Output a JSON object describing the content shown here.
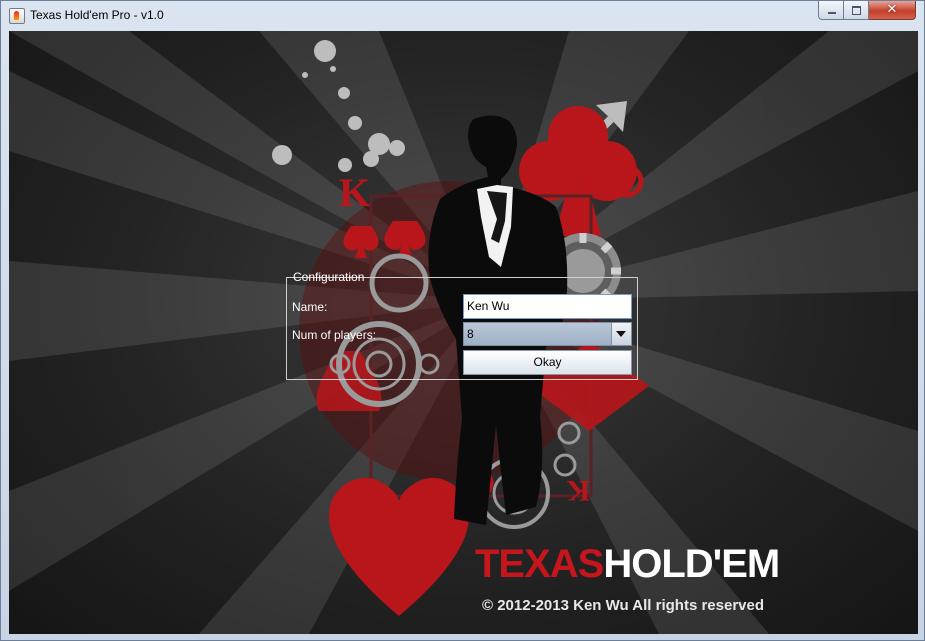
{
  "window": {
    "title": "Texas Hold'em Pro - v1.0",
    "close_glyph": "✕"
  },
  "config": {
    "legend": "Configuration",
    "name_label": "Name:",
    "name_value": "Ken Wu",
    "players_label": "Num of players:",
    "players_value": "8",
    "okay_label": "Okay"
  },
  "brand": {
    "part1": "TEXAS",
    "part2": "HOLD'EM"
  },
  "copyright": "© 2012-2013 Ken Wu All rights reserved",
  "colors": {
    "accent_red": "#c4161c",
    "background": "#222222"
  }
}
